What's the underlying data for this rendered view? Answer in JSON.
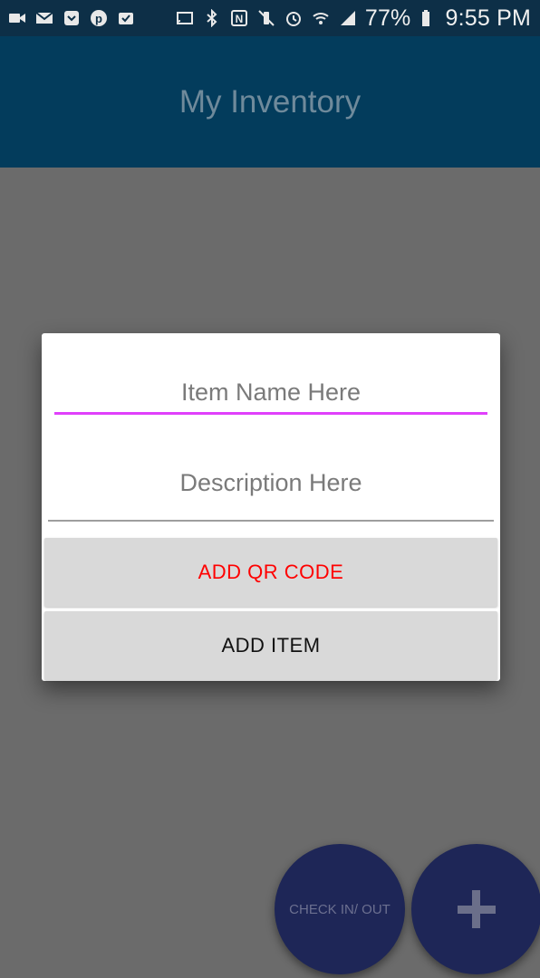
{
  "status_bar": {
    "left_icons": [
      "video-icon",
      "gmail-icon",
      "save-pocket-icon",
      "pinterest-icon",
      "inbox-icon"
    ],
    "right_icons": [
      "cast-icon",
      "bluetooth-icon",
      "nfc-icon",
      "vibrate-icon",
      "alarm-icon",
      "wifi-icon",
      "signal-icon",
      "battery-icon"
    ],
    "battery": "77%",
    "time": "9:55 PM",
    "background": "#0d2f47"
  },
  "app_bar": {
    "title": "My Inventory",
    "background": "#033c5c"
  },
  "dialog": {
    "item_name_placeholder": "Item Name Here",
    "description_placeholder": "Description Here",
    "add_qr_code_label": "ADD QR CODE",
    "add_item_label": "ADD ITEM",
    "focus_underline_color": "#e040fb",
    "qr_label_color": "#ff0000"
  },
  "fabs": {
    "check_in_out_label": "CHECK IN/ OUT",
    "add_icon": "plus-icon",
    "color": "#1e2657"
  }
}
